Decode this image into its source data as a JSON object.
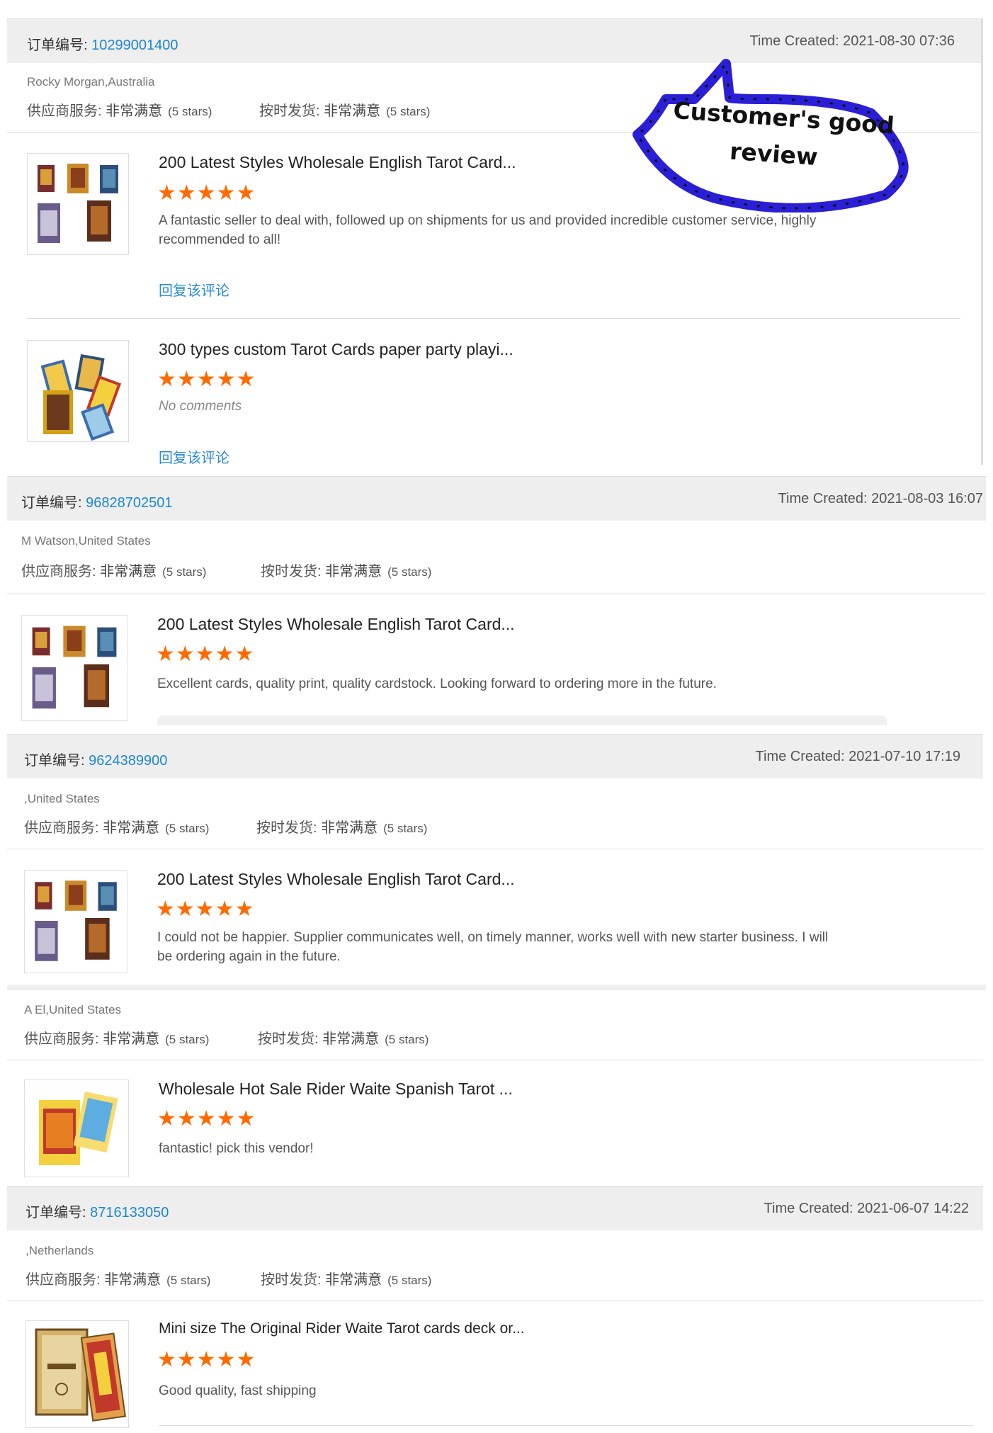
{
  "labels": {
    "order_no": "订单编号: ",
    "time_created": "Time Created: ",
    "supplier_service": "供应商服务: ",
    "on_time_delivery": "按时发货: ",
    "very_satisfied": "非常满意",
    "five_stars": "(5 stars)",
    "reply": "回复该评论",
    "stars": "★★★★★"
  },
  "callout": {
    "line1": "Customer's good",
    "line2": "review"
  },
  "orders": [
    {
      "order_no": "10299001400",
      "time": "2021-08-30 07:36",
      "buyer": "Rocky Morgan,Australia",
      "products": [
        {
          "title": "200 Latest Styles Wholesale English Tarot Card...",
          "comment": "A fantastic seller to deal with, followed up on shipments for us and provided incredible customer service, highly recommended to all!"
        },
        {
          "title": "300 types custom Tarot Cards paper party playi...",
          "comment": "No comments"
        }
      ]
    },
    {
      "order_no": "96828702501",
      "time": "2021-08-03 16:07",
      "buyer": "M  Watson,United States",
      "products": [
        {
          "title": "200 Latest Styles Wholesale English Tarot Card...",
          "comment": "Excellent cards, quality print, quality cardstock. Looking forward to ordering more in the future."
        }
      ]
    },
    {
      "order_no": "9624389900",
      "time": "2021-07-10 17:19",
      "buyer": ",United States",
      "products": [
        {
          "title": "200 Latest Styles Wholesale English Tarot Card...",
          "comment": "I could not be happier. Supplier communicates well, on timely manner, works well with new starter business. I will be ordering again in the future."
        }
      ]
    },
    {
      "buyer": "A  El,United States",
      "products": [
        {
          "title": "Wholesale Hot Sale Rider Waite Spanish Tarot ...",
          "comment": "fantastic! pick this vendor!"
        }
      ]
    },
    {
      "order_no": "8716133050",
      "time": "2021-06-07 14:22",
      "buyer": ",Netherlands",
      "products": [
        {
          "title": "Mini size The Original Rider Waite Tarot cards deck or...",
          "comment": "Good quality, fast shipping"
        }
      ]
    }
  ],
  "colors": {
    "link": "#1c87d0",
    "star": "#ff6a00",
    "callout_border": "#2a1fd6"
  }
}
